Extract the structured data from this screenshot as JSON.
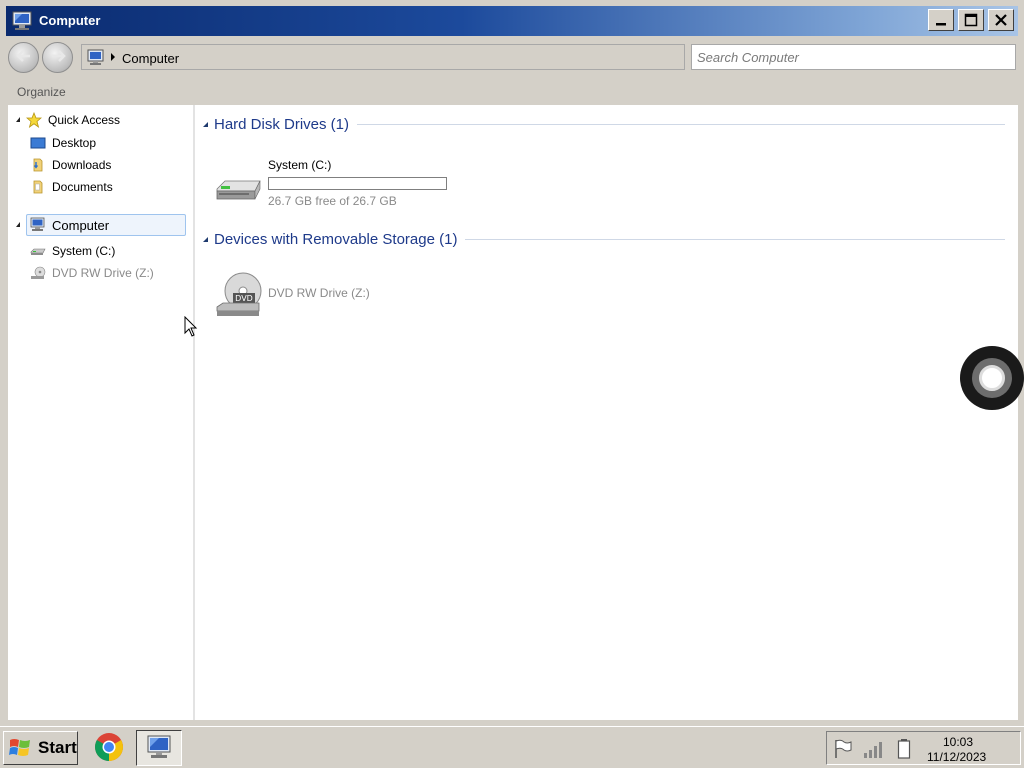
{
  "window": {
    "title": "Computer",
    "controls": {
      "minimize": "minimize-icon",
      "maximize": "maximize-icon",
      "close": "close-icon"
    }
  },
  "address": {
    "path": "Computer",
    "search_placeholder": "Search Computer"
  },
  "toolbar": {
    "organize": "Organize"
  },
  "nav_pane": {
    "quick_access": {
      "label": "Quick Access",
      "items": [
        {
          "label": "Desktop",
          "icon": "desktop-icon"
        },
        {
          "label": "Downloads",
          "icon": "downloads-folder-icon"
        },
        {
          "label": "Documents",
          "icon": "documents-folder-icon"
        }
      ]
    },
    "computer": {
      "label": "Computer",
      "items": [
        {
          "label": "System (C:)",
          "icon": "hard-drive-icon"
        },
        {
          "label": "DVD RW Drive (Z:)",
          "icon": "dvd-drive-icon"
        }
      ]
    }
  },
  "content": {
    "groups": [
      {
        "header": "Hard Disk Drives (1)",
        "drives": [
          {
            "name": "System (C:)",
            "free_text": "26.7 GB free of 26.7 GB",
            "used_fraction": 0.0
          }
        ]
      },
      {
        "header": "Devices with Removable Storage (1)",
        "drives": [
          {
            "name": "DVD RW Drive (Z:)"
          }
        ]
      }
    ]
  },
  "taskbar": {
    "start_label": "Start",
    "apps": [
      "chrome-icon",
      "computer-explorer-icon"
    ],
    "tray": {
      "icons": [
        "flag-icon",
        "network-signal-icon",
        "battery-icon"
      ],
      "time": "10:03",
      "date": "11/12/2023"
    }
  },
  "colors": {
    "title_gradient_start": "#0a2a6e",
    "title_gradient_end": "#a8c4e6",
    "group_header": "#1e3a8a",
    "selection_border": "#9fc4ee"
  }
}
